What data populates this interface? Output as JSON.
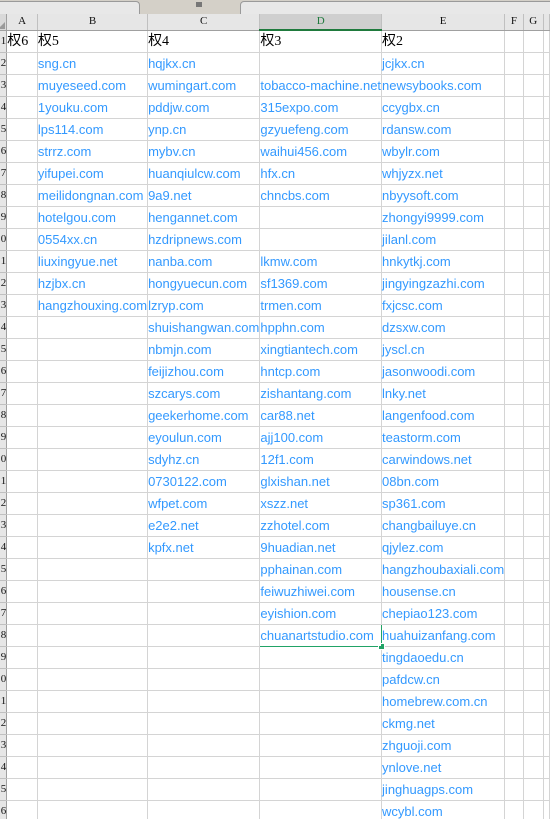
{
  "app": {
    "type": "spreadsheet",
    "accent_green": "#21a366",
    "link_blue": "#3399ff",
    "header_gray": "#e6e6e6"
  },
  "column_headers": [
    "A",
    "B",
    "C",
    "D",
    "E",
    "F",
    "G",
    ""
  ],
  "selected_column": "D",
  "selected_cell": "D28",
  "row_headers": [
    "1",
    "2",
    "3",
    "4",
    "5",
    "6",
    "7",
    "8",
    "9",
    "0",
    "1",
    "2",
    "3",
    "4",
    "5",
    "6",
    "7",
    "8",
    "9",
    "0",
    "1",
    "2",
    "3",
    "4",
    "5",
    "6",
    "7",
    "8",
    "9",
    "0",
    "1",
    "2",
    "3",
    "4",
    "5",
    "6"
  ],
  "columns": {
    "A": "权6",
    "B": "权5",
    "C": "权4",
    "D": "权3",
    "E": "权2"
  },
  "rows": [
    {
      "A": "权6",
      "B": "权5",
      "C": "权4",
      "D": "权3",
      "E": "权2",
      "header": true
    },
    {
      "A": "",
      "B": "sng.cn",
      "C": "hqjkx.cn",
      "D": "",
      "E": "jcjkx.cn"
    },
    {
      "A": "",
      "B": "muyeseed.com",
      "C": "wumingart.com",
      "D": "tobacco-machine.net",
      "E": "newsybooks.com"
    },
    {
      "A": "",
      "B": "1youku.com",
      "C": "pddjw.com",
      "D": "315expo.com",
      "E": "ccygbx.cn"
    },
    {
      "A": "",
      "B": "lps114.com",
      "C": "ynp.cn",
      "D": "gzyuefeng.com",
      "E": "rdansw.com"
    },
    {
      "A": "",
      "B": "strrz.com",
      "C": "mybv.cn",
      "D": "waihui456.com",
      "E": "wbylr.com"
    },
    {
      "A": "",
      "B": "yifupei.com",
      "C": "huanqiulcw.com",
      "D": "hfx.cn",
      "E": "whjyzx.net"
    },
    {
      "A": "",
      "B": "meilidongnan.com",
      "C": "9a9.net",
      "D": "chncbs.com",
      "E": "nbyysoft.com"
    },
    {
      "A": "",
      "B": "hotelgou.com",
      "C": "hengannet.com",
      "D": "",
      "E": "zhongyi9999.com"
    },
    {
      "A": "",
      "B": "0554xx.cn",
      "C": "hzdripnews.com",
      "D": "",
      "E": "jilanl.com"
    },
    {
      "A": "",
      "B": "liuxingyue.net",
      "C": "nanba.com",
      "D": "lkmw.com",
      "E": "hnkytkj.com"
    },
    {
      "A": "",
      "B": "hzjbx.cn",
      "C": "hongyuecun.com",
      "D": "sf1369.com",
      "E": "jingyingzazhi.com"
    },
    {
      "A": "",
      "B": "hangzhouxing.com",
      "C": "lzryp.com",
      "D": "trmen.com",
      "E": "fxjcsc.com"
    },
    {
      "A": "",
      "B": "",
      "C": "shuishangwan.com",
      "D": "hpphn.com",
      "E": "dzsxw.com"
    },
    {
      "A": "",
      "B": "",
      "C": "nbmjn.com",
      "D": "xingtiantech.com",
      "E": "jyscl.cn"
    },
    {
      "A": "",
      "B": "",
      "C": "feijizhou.com",
      "D": "hntcp.com",
      "E": "jasonwoodi.com"
    },
    {
      "A": "",
      "B": "",
      "C": "szcarys.com",
      "D": "zishantang.com",
      "E": "lnky.net"
    },
    {
      "A": "",
      "B": "",
      "C": "geekerhome.com",
      "D": "car88.net",
      "E": "langenfood.com"
    },
    {
      "A": "",
      "B": "",
      "C": "eyoulun.com",
      "D": "ajj100.com",
      "E": "teastorm.com"
    },
    {
      "A": "",
      "B": "",
      "C": "sdyhz.cn",
      "D": "12f1.com",
      "E": "carwindows.net"
    },
    {
      "A": "",
      "B": "",
      "C": "0730122.com",
      "D": "glxishan.net",
      "E": "08bn.com"
    },
    {
      "A": "",
      "B": "",
      "C": "wfpet.com",
      "D": "xszz.net",
      "E": "sp361.com"
    },
    {
      "A": "",
      "B": "",
      "C": "e2e2.net",
      "D": "zzhotel.com",
      "E": "changbailuye.cn"
    },
    {
      "A": "",
      "B": "",
      "C": "kpfx.net",
      "D": "9huadian.net",
      "E": "qjylez.com"
    },
    {
      "A": "",
      "B": "",
      "C": "",
      "D": "pphainan.com",
      "E": "hangzhoubaxiali.com"
    },
    {
      "A": "",
      "B": "",
      "C": "",
      "D": "feiwuzhiwei.com",
      "E": "housense.cn"
    },
    {
      "A": "",
      "B": "",
      "C": "",
      "D": "eyishion.com",
      "E": "chepiao123.com"
    },
    {
      "A": "",
      "B": "",
      "C": "",
      "D": "chuanartstudio.com",
      "E": "huahuizanfang.com",
      "selected": "D"
    },
    {
      "A": "",
      "B": "",
      "C": "",
      "D": "",
      "E": "tingdaoedu.cn"
    },
    {
      "A": "",
      "B": "",
      "C": "",
      "D": "",
      "E": "pafdcw.cn"
    },
    {
      "A": "",
      "B": "",
      "C": "",
      "D": "",
      "E": "homebrew.com.cn"
    },
    {
      "A": "",
      "B": "",
      "C": "",
      "D": "",
      "E": "ckmg.net"
    },
    {
      "A": "",
      "B": "",
      "C": "",
      "D": "",
      "E": "zhguoji.com"
    },
    {
      "A": "",
      "B": "",
      "C": "",
      "D": "",
      "E": "ynlove.net"
    },
    {
      "A": "",
      "B": "",
      "C": "",
      "D": "",
      "E": "jinghuagps.com"
    },
    {
      "A": "",
      "B": "",
      "C": "",
      "D": "",
      "E": "wcybl.com"
    }
  ]
}
